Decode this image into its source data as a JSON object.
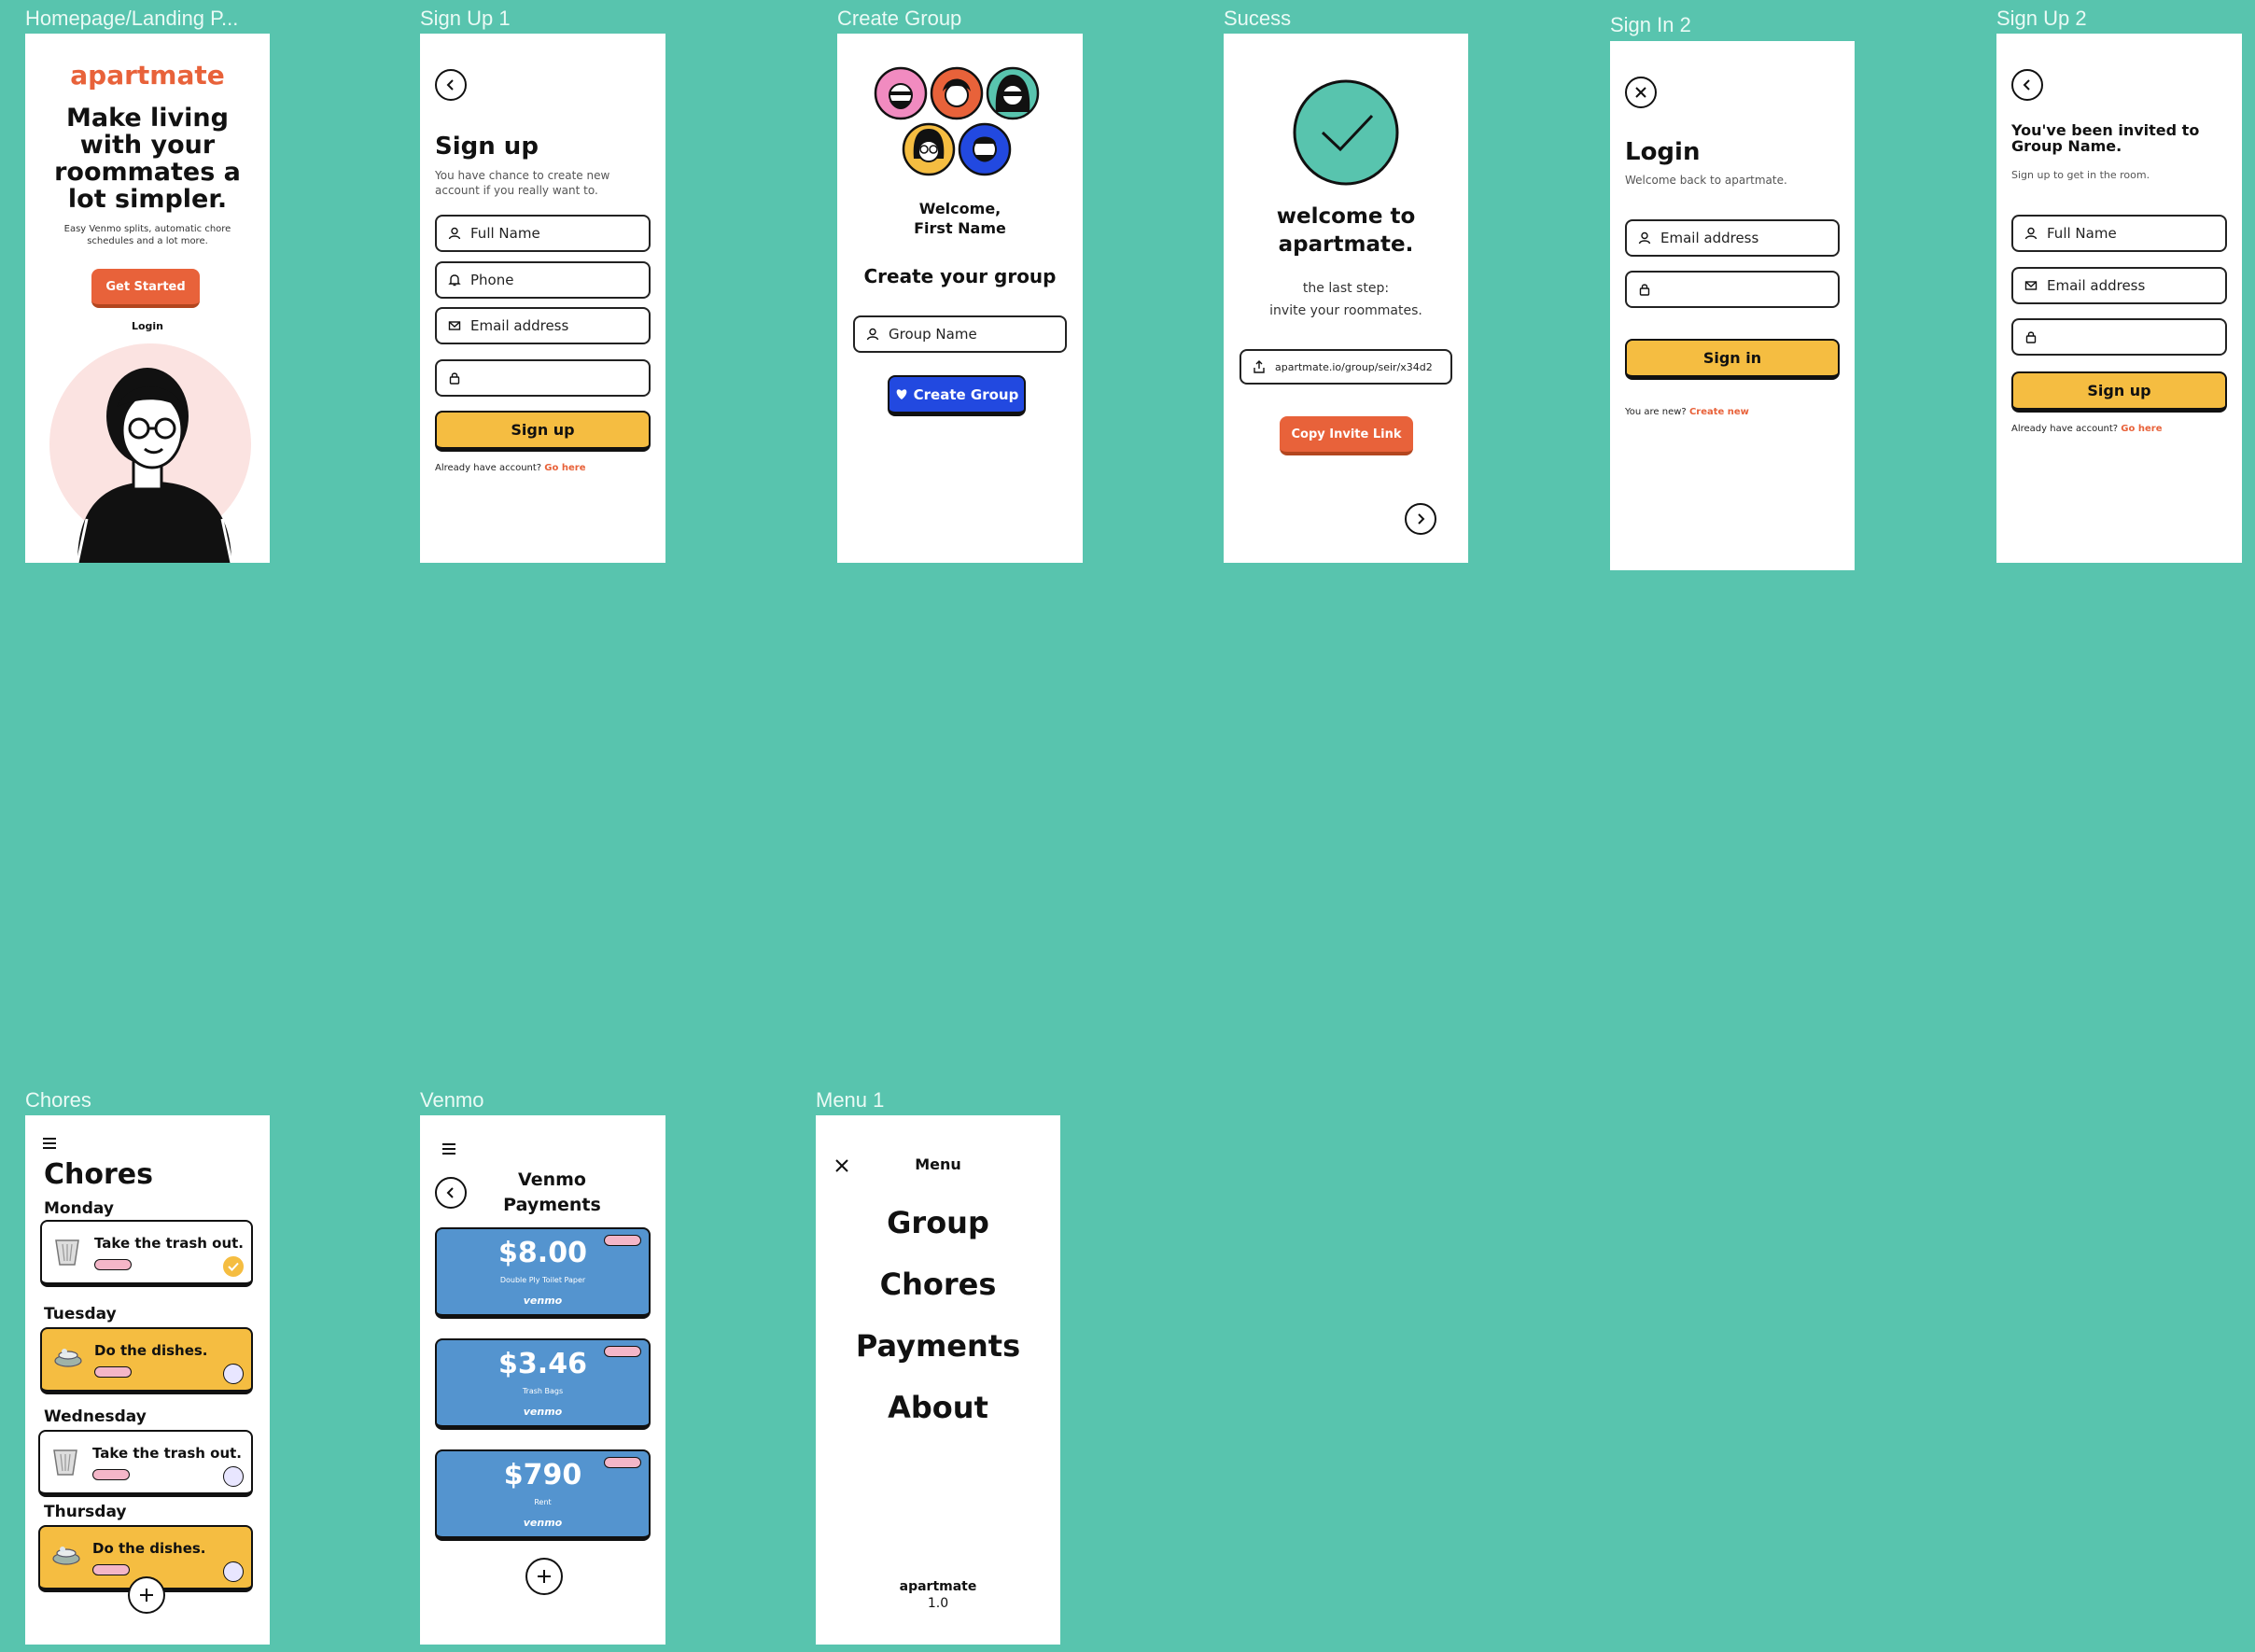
{
  "labels": {
    "home": "Homepage/Landing P...",
    "signup1": "Sign Up 1",
    "create": "Create Group",
    "success": "Sucess",
    "signin2": "Sign In 2",
    "signup2": "Sign Up 2",
    "chores": "Chores",
    "venmo": "Venmo",
    "menu1": "Menu 1"
  },
  "home": {
    "brand": "apartmate",
    "headline": "Make living with your roommates a lot simpler.",
    "sub": "Easy Venmo splits, automatic chore schedules and a lot more.",
    "cta": "Get Started",
    "login": "Login"
  },
  "signup1": {
    "title": "Sign up",
    "sub": "You have chance to create new account if you really want to.",
    "full_name": "Full Name",
    "phone": "Phone",
    "email": "Email address",
    "button": "Sign up",
    "note": "Already have account?",
    "link": "Go here"
  },
  "create": {
    "welcome_line1": "Welcome,",
    "welcome_line2": "First Name",
    "title": "Create your group",
    "group_placeholder": "Group Name",
    "button": "Create Group"
  },
  "success": {
    "title": "welcome to apartmate.",
    "step": "the last step:",
    "step2": "invite your roommates.",
    "link": "apartmate.io/group/seir/x34d2",
    "button": "Copy Invite Link"
  },
  "signin2": {
    "title": "Login",
    "sub": "Welcome back to apartmate.",
    "email": "Email address",
    "button": "Sign in",
    "note": "You are new?",
    "link": "Create new"
  },
  "signup2": {
    "title": "You've been invited to Group Name.",
    "sub": "Sign up to get in the room.",
    "full_name": "Full Name",
    "email": "Email address",
    "button": "Sign up",
    "note": "Already have account?",
    "link": "Go here"
  },
  "chores": {
    "title": "Chores",
    "days": [
      "Monday",
      "Tuesday",
      "Wednesday",
      "Thursday"
    ],
    "items": [
      "Take the trash out.",
      "Do the dishes.",
      "Take the trash out.",
      "Do the dishes."
    ]
  },
  "venmo": {
    "title_line1": "Venmo",
    "title_line2": "Payments",
    "payments": [
      {
        "amount": "$8.00",
        "desc": "Double Ply Toilet Paper"
      },
      {
        "amount": "$3.46",
        "desc": "Trash Bags"
      },
      {
        "amount": "$790",
        "desc": "Rent"
      }
    ],
    "brand": "venmo"
  },
  "menu": {
    "title": "Menu",
    "items": [
      "Group",
      "Chores",
      "Payments",
      "About"
    ],
    "footer_name": "apartmate",
    "footer_version": "1.0"
  },
  "colors": {
    "background": "#58c4ae",
    "orange": "#e8623a",
    "yellow": "#f5bd41",
    "blue": "#2249e0",
    "venmo_blue": "#5494cf"
  }
}
